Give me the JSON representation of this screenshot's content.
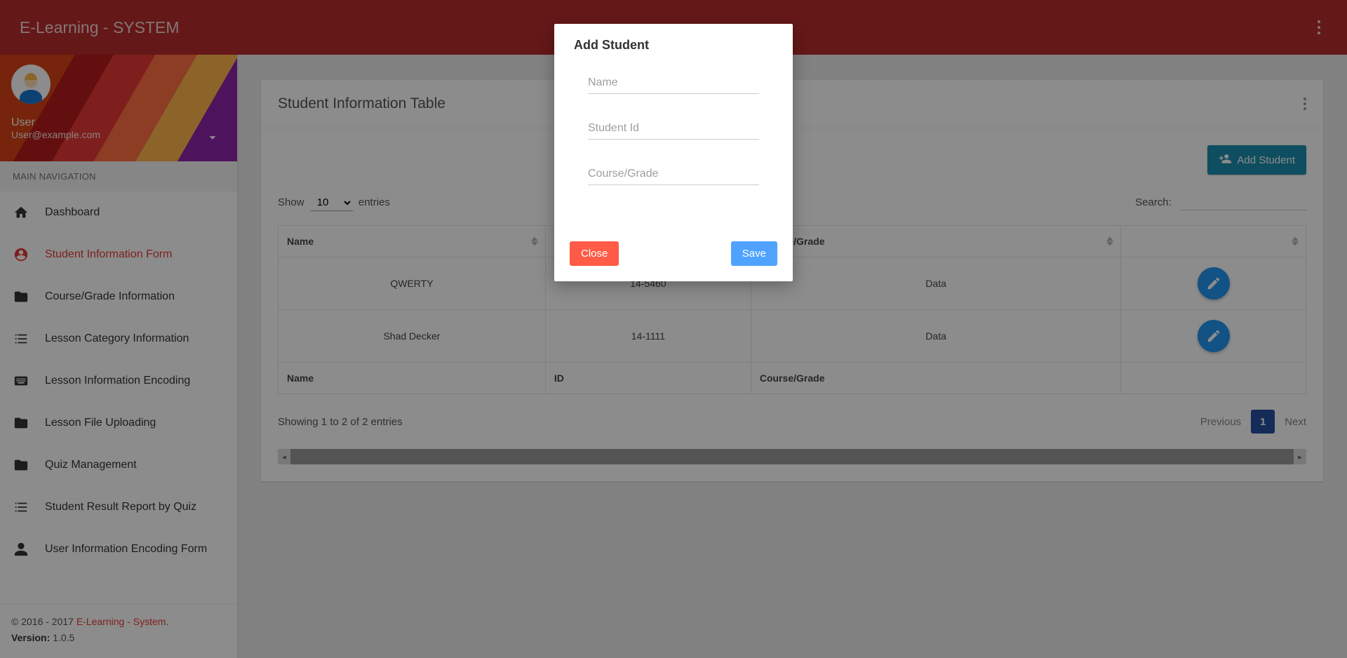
{
  "topbar": {
    "title": "E-Learning - SYSTEM"
  },
  "user": {
    "name": "User",
    "email": "User@example.com"
  },
  "nav": {
    "header": "MAIN NAVIGATION",
    "items": [
      {
        "label": "Dashboard"
      },
      {
        "label": "Student Information Form"
      },
      {
        "label": "Course/Grade Information"
      },
      {
        "label": "Lesson Category Information"
      },
      {
        "label": "Lesson Information Encoding"
      },
      {
        "label": "Lesson File Uploading"
      },
      {
        "label": "Quiz Management"
      },
      {
        "label": "Student Result Report by Quiz"
      },
      {
        "label": "User Information Encoding Form"
      }
    ]
  },
  "footer": {
    "copy_prefix": "© 2016 - 2017 ",
    "link": "E-Learning - System",
    "dot": ".",
    "version_label": "Version:",
    "version": "1.0.5"
  },
  "card": {
    "title": "Student Information Table",
    "add_button": "Add Student",
    "show_label": "Show",
    "entries_label": "entries",
    "page_length": "10",
    "search_label": "Search:",
    "columns": {
      "c0": "Name",
      "c1": "ID",
      "c2": "Course/Grade"
    },
    "rows": [
      {
        "name": "QWERTY",
        "id": "14-5460",
        "course": "Data"
      },
      {
        "name": "Shad Decker",
        "id": "14-1111",
        "course": "Data"
      }
    ],
    "info": "Showing 1 to 2 of 2 entries",
    "pager": {
      "prev": "Previous",
      "page": "1",
      "next": "Next"
    }
  },
  "modal": {
    "title": "Add Student",
    "fields": {
      "name_ph": "Name",
      "studentid_ph": "Student Id",
      "course_ph": "Course/Grade"
    },
    "close": "Close",
    "save": "Save"
  }
}
